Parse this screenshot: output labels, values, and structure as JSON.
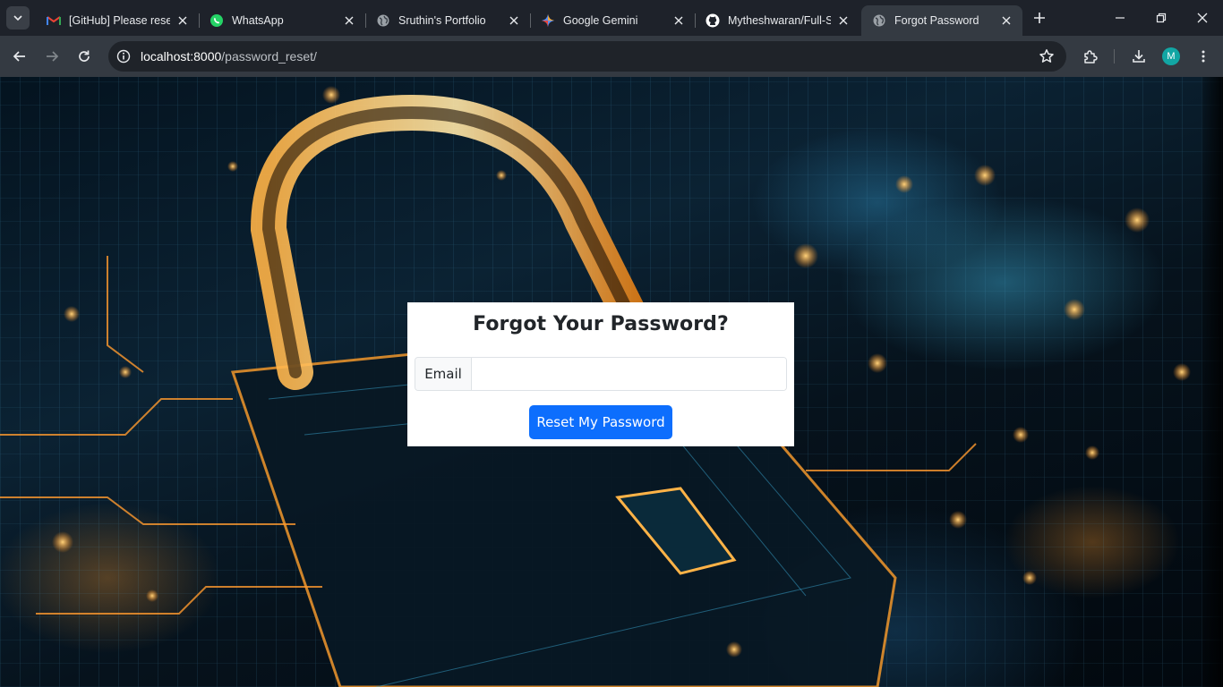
{
  "browser": {
    "tabs": [
      {
        "title": "[GitHub] Please reset",
        "icon": "gmail-icon"
      },
      {
        "title": "WhatsApp",
        "icon": "whatsapp-icon"
      },
      {
        "title": "Sruthin's Portfolio",
        "icon": "globe-icon"
      },
      {
        "title": "Google Gemini",
        "icon": "gemini-icon"
      },
      {
        "title": "Mytheshwaran/Full-S",
        "icon": "github-icon"
      },
      {
        "title": "Forgot Password",
        "icon": "globe-icon",
        "active": true
      }
    ],
    "address": {
      "host": "localhost:8000",
      "path": "/password_reset/"
    },
    "profile_initial": "M",
    "accent_color": "#12a6a4"
  },
  "page": {
    "title": "Forgot Your Password?",
    "email_label": "Email",
    "email_value": "",
    "submit_label": "Reset My Password",
    "button_color": "#0d6efd",
    "background_image": "digital-padlock-circuit-background"
  }
}
